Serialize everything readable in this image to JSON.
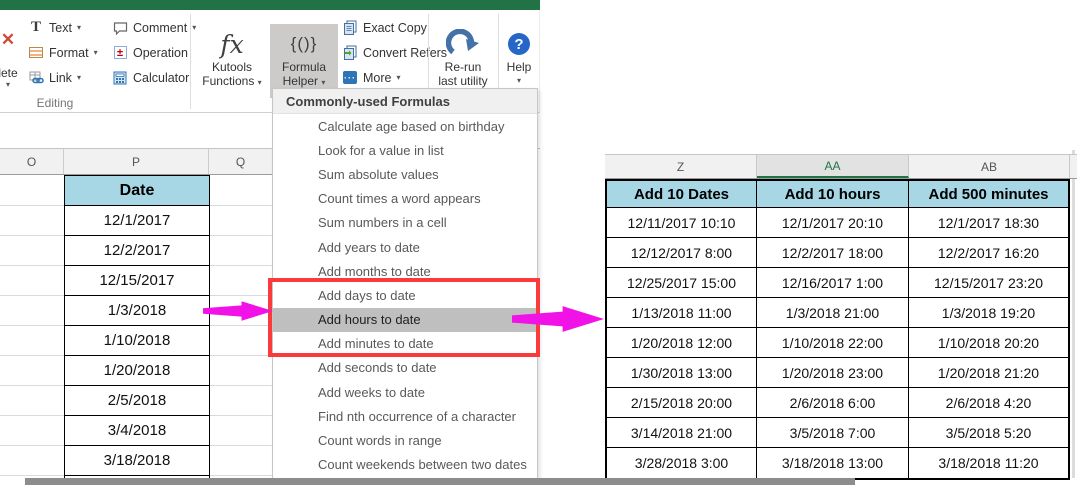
{
  "ribbon": {
    "delete_button_partial_label": "lete",
    "delete_icon_glyph": "✕",
    "text_button": "Text",
    "text_icon_glyph": "T",
    "format_button": "Format",
    "link_button": "Link",
    "comment_button": "Comment",
    "operation_button": "Operation",
    "operation_icon_glyph": "±",
    "calculator_button": "Calculator",
    "group_label": "Editing",
    "kutools_functions_button": {
      "icon_glyph": "fx",
      "line1": "Kutools",
      "line2": "Functions"
    },
    "formula_helper_button": {
      "icon_glyph": "{()}",
      "line1": "Formula",
      "line2": "Helper"
    },
    "exact_copy_button": "Exact Copy",
    "convert_refers_button": "Convert Refers",
    "more_button": "More",
    "more_icon_glyph": "···",
    "rerun_button": {
      "line1": "Re-run",
      "line2": "last utility"
    },
    "help_button": "Help",
    "help_icon_glyph": "?",
    "dropdown_glyph": "▾"
  },
  "menu": {
    "header": "Commonly-used Formulas",
    "items": [
      "Calculate age based on birthday",
      "Look for a value in list",
      "Sum absolute values",
      "Count times a word appears",
      "Sum numbers in a cell",
      "Add years to date",
      "Add months to date",
      "Add days to date",
      "Add hours to date",
      "Add minutes to date",
      "Add seconds to date",
      "Add weeks to date",
      "Find nth occurrence of a character",
      "Count words in range",
      "Count weekends between two dates"
    ],
    "highlighted_item": "Add hours to date",
    "red_boxed_items": [
      "Add days to date",
      "Add hours to date",
      "Add minutes to date"
    ]
  },
  "left_sheet": {
    "column_letters": [
      "O",
      "P",
      "Q"
    ],
    "header": "Date",
    "dates": [
      "12/1/2017",
      "12/2/2017",
      "12/15/2017",
      "1/3/2018",
      "1/10/2018",
      "1/20/2018",
      "2/5/2018",
      "3/4/2018",
      "3/18/2018"
    ]
  },
  "right_sheet": {
    "column_letters": [
      "Z",
      "AA",
      "AB"
    ],
    "selected_column_letter": "AA",
    "headers": [
      "Add 10 Dates",
      "Add 10 hours",
      "Add 500 minutes"
    ],
    "rows": [
      [
        "12/11/2017 10:10",
        "12/1/2017 20:10",
        "12/1/2017 18:30"
      ],
      [
        "12/12/2017 8:00",
        "12/2/2017 18:00",
        "12/2/2017 16:20"
      ],
      [
        "12/25/2017 15:00",
        "12/16/2017 1:00",
        "12/15/2017 23:20"
      ],
      [
        "1/13/2018 11:00",
        "1/3/2018 21:00",
        "1/3/2018 19:20"
      ],
      [
        "1/20/2018 12:00",
        "1/10/2018 22:00",
        "1/10/2018 20:20"
      ],
      [
        "1/30/2018 13:00",
        "1/20/2018 23:00",
        "1/20/2018 21:20"
      ],
      [
        "2/15/2018 20:00",
        "2/6/2018 6:00",
        "2/6/2018 4:20"
      ],
      [
        "3/14/2018 21:00",
        "3/5/2018 7:00",
        "3/5/2018 5:20"
      ],
      [
        "3/28/2018 3:00",
        "3/18/2018 13:00",
        "3/18/2018 11:20"
      ]
    ]
  },
  "colors": {
    "excel_green": "#217346",
    "table_header_blue": "#a7d7e5",
    "menu_highlight_gray": "#bfbfbf",
    "red_annotation_box": "#fb3b3b",
    "magenta_arrow": "#f112e8",
    "help_blue": "#2666c8",
    "icon_blue": "#41719c"
  }
}
